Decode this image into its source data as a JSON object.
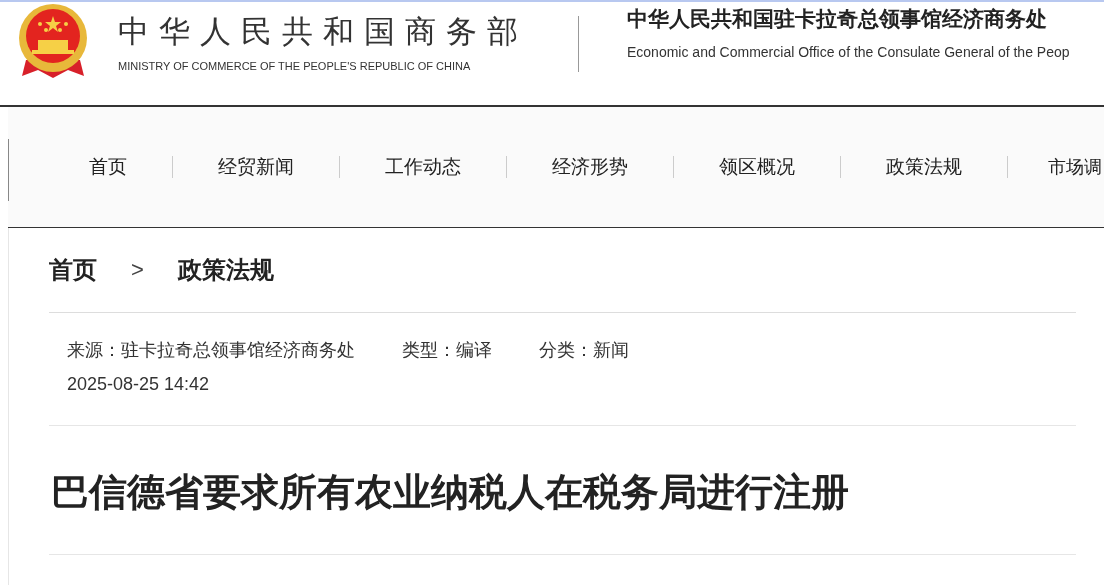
{
  "header": {
    "ministry_name": "中华人民共和国商务部",
    "ministry_name_en": "MINISTRY OF COMMERCE OF THE PEOPLE'S REPUBLIC OF CHINA",
    "office_name": "中华人民共和国驻卡拉奇总领事馆经济商务处",
    "office_name_en": "Economic and Commercial Office of the Consulate General of the Peop"
  },
  "nav": [
    "首页",
    "经贸新闻",
    "工作动态",
    "经济形势",
    "领区概况",
    "政策法规",
    "市场调"
  ],
  "breadcrumb": {
    "items": [
      "首页",
      "政策法规"
    ],
    "separator": ">"
  },
  "meta": {
    "source": "来源：驻卡拉奇总领事馆经济商务处",
    "type": "类型：编译",
    "category": "分类：新闻",
    "date": "2025-08-25 14:42"
  },
  "article": {
    "title": "巴信德省要求所有农业纳税人在税务局进行注册"
  }
}
